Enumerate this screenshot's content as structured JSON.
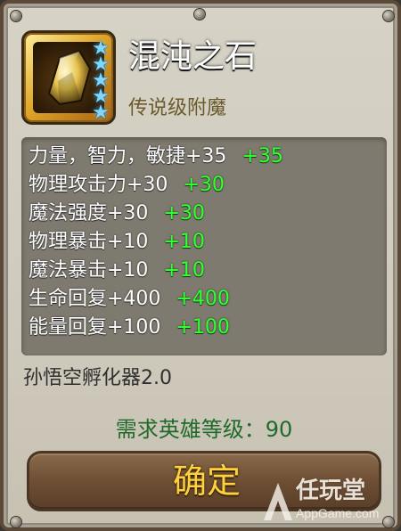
{
  "item": {
    "name": "混沌之石",
    "rarity": "传说级附魔",
    "stars": 5,
    "source": "孙悟空孵化器2.0"
  },
  "stats": [
    {
      "label": "力量，智力，敏捷+35",
      "bonus": "+35"
    },
    {
      "label": "物理攻击力+30",
      "bonus": "+30"
    },
    {
      "label": "魔法强度+30",
      "bonus": "+30"
    },
    {
      "label": "物理暴击+10",
      "bonus": "+10"
    },
    {
      "label": "魔法暴击+10",
      "bonus": "+10"
    },
    {
      "label": "生命回复+400",
      "bonus": "+400"
    },
    {
      "label": "能量回复+100",
      "bonus": "+100"
    }
  ],
  "requirement": {
    "label": "需求英雄等级：",
    "value": "90"
  },
  "confirm_label": "确定",
  "watermark": {
    "title": "任玩堂",
    "subtitle": "AppGame.com"
  },
  "icons": {
    "item": "chaos-stone-icon",
    "star": "star-icon",
    "watermark": "appgame-logo-icon"
  },
  "colors": {
    "stat_text": "#ffffff",
    "bonus_text": "#36ff36",
    "requirement_text": "#1f6a2b",
    "confirm_text": "#ffd23b",
    "rarity_text": "#6b5a2b"
  }
}
